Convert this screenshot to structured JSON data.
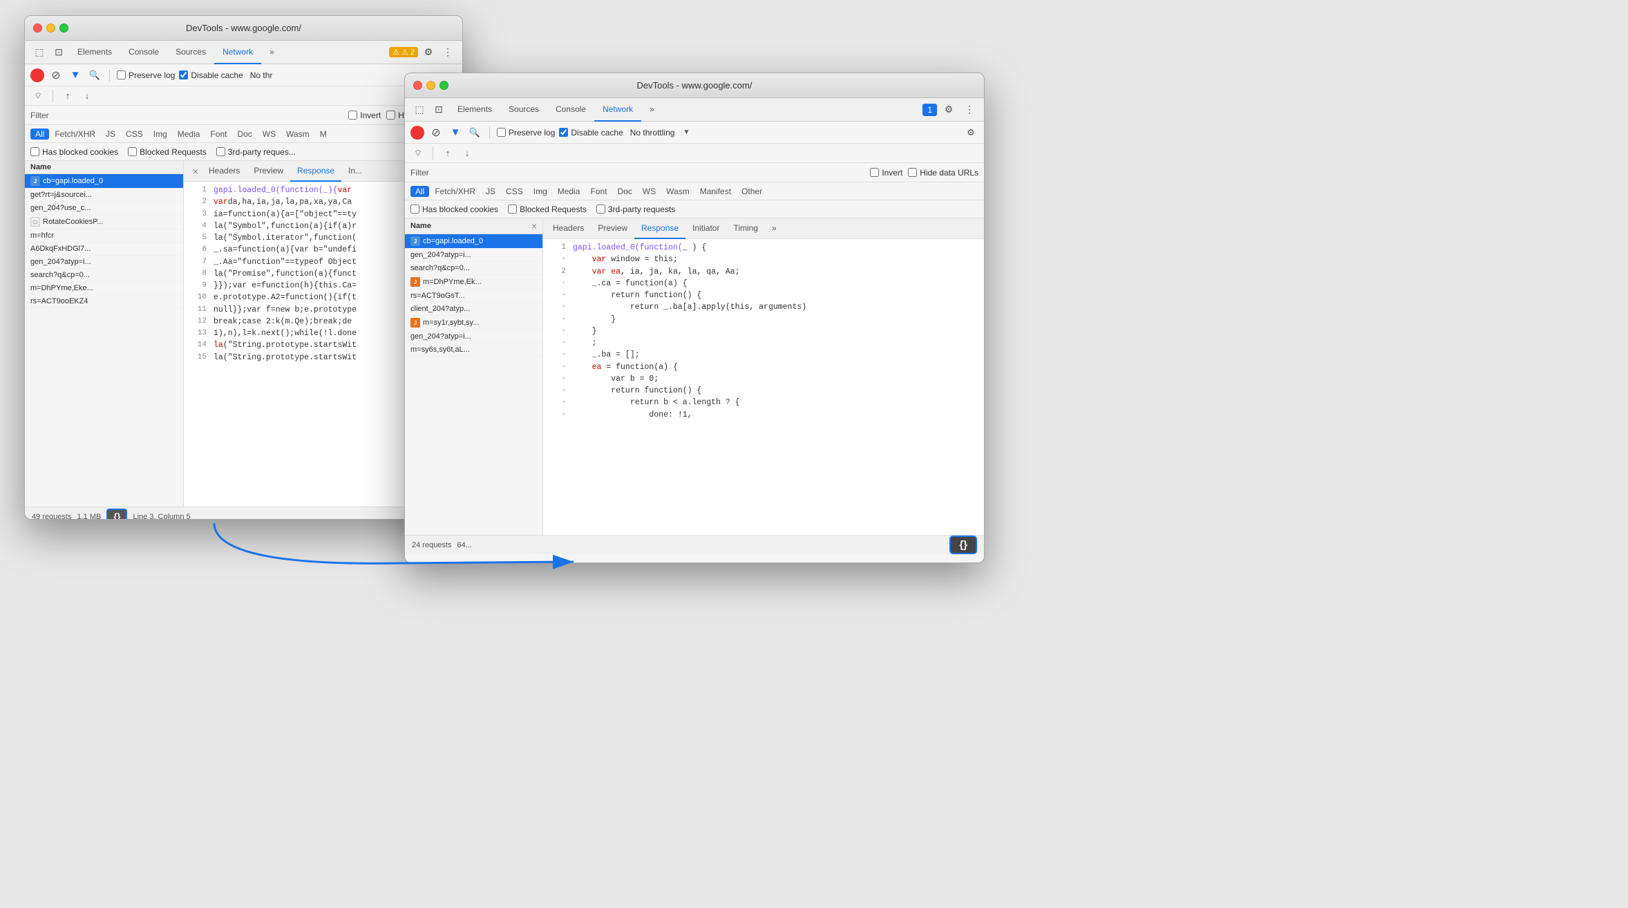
{
  "window1": {
    "title": "DevTools - www.google.com/",
    "tabs": [
      {
        "label": "Elements",
        "active": false
      },
      {
        "label": "Console",
        "active": false
      },
      {
        "label": "Sources",
        "active": false
      },
      {
        "label": "Network",
        "active": true
      },
      {
        "label": "»",
        "active": false
      }
    ],
    "badgeLabel": "⚠ 2",
    "toolbar": {
      "preserveLog": "Preserve log",
      "disableCache": "Disable cache",
      "noThrottle": "No thr"
    },
    "filter": {
      "label": "Filter",
      "invertLabel": "Invert",
      "hideDataURLs": "Hide data URLs"
    },
    "typeFilters": [
      "All",
      "Fetch/XHR",
      "JS",
      "CSS",
      "Img",
      "Media",
      "Font",
      "Doc",
      "WS",
      "Wasm",
      "M"
    ],
    "checkboxes": {
      "hasCookies": "Has blocked cookies",
      "blockedRequests": "Blocked Requests",
      "thirdParty": "3rd-party reques..."
    },
    "requestsHeader": "Name",
    "requests": [
      {
        "name": "cb=gapi.loaded_0",
        "icon": "blue",
        "selected": true
      },
      {
        "name": "get?rt=j&sourcei...",
        "icon": "none"
      },
      {
        "name": "gen_204?use_c...",
        "icon": "none"
      },
      {
        "name": "RotateCookiesP...",
        "icon": "page"
      },
      {
        "name": "m=hfcr",
        "icon": "none"
      },
      {
        "name": "A6DkqFxHDGl7...",
        "icon": "none"
      },
      {
        "name": "gen_204?atyp=i...",
        "icon": "none"
      },
      {
        "name": "search?q&cp=0...",
        "icon": "none"
      },
      {
        "name": "m=DhPYme,Eke...",
        "icon": "none"
      },
      {
        "name": "rs=ACT9ooEKZ4",
        "icon": "none"
      }
    ],
    "tabs2": [
      "Headers",
      "Preview",
      "Response",
      "In..."
    ],
    "codeLines": [
      {
        "num": "1",
        "text": "gapi.loaded_0(function(_){var "
      },
      {
        "num": "2",
        "text": "var da,ha,ia,ja,la,pa,xa,ya,Ca"
      },
      {
        "num": "3",
        "text": "ia=function(a){a=[\"object\"==ty"
      },
      {
        "num": "4",
        "text": "la(\"Symbol\",function(a){if(a)r"
      },
      {
        "num": "5",
        "text": "la(\"Symbol.iterator\",function("
      },
      {
        "num": "6",
        "text": "_.sa=function(a){var b=\"undefi"
      },
      {
        "num": "7",
        "text": "_.Aa=\"function\"==typeof Object"
      },
      {
        "num": "8",
        "text": "la(\"Promise\",function(a){funct"
      },
      {
        "num": "9",
        "text": "}});var e=function(h){this.Ca="
      },
      {
        "num": "10",
        "text": "e.prototype.A2=function(){if(t"
      },
      {
        "num": "11",
        "text": "null}};var f=new b;e.prototype"
      },
      {
        "num": "12",
        "text": "break;case 2:k(m.Qe);break;de"
      },
      {
        "num": "13",
        "text": "1),n),l=k.next();while(!l.done"
      },
      {
        "num": "14",
        "text": "la(\"String.prototype.startsWith"
      }
    ],
    "statusBar": {
      "requests": "49 requests",
      "size": "1.1 MB",
      "formatBtnLabel": "{}",
      "position": "Line 3, Column 5"
    }
  },
  "window2": {
    "title": "DevTools - www.google.com/",
    "tabs": [
      {
        "label": "Elements",
        "active": false
      },
      {
        "label": "Sources",
        "active": false
      },
      {
        "label": "Console",
        "active": false
      },
      {
        "label": "Network",
        "active": true
      },
      {
        "label": "»",
        "active": false
      }
    ],
    "badgeLabel": "1",
    "toolbar": {
      "preserveLog": "Preserve log",
      "disableCache": "Disable cache",
      "noThrottle": "No throttling"
    },
    "filter": {
      "label": "Filter",
      "invertLabel": "Invert",
      "hideDataURLs": "Hide data URLs"
    },
    "typeFilters": [
      "All",
      "Fetch/XHR",
      "JS",
      "CSS",
      "Img",
      "Media",
      "Font",
      "Doc",
      "WS",
      "Wasm",
      "Manifest",
      "Other"
    ],
    "checkboxes": {
      "hasCookies": "Has blocked cookies",
      "blockedRequests": "Blocked Requests",
      "thirdParty": "3rd-party requests"
    },
    "requestsHeader": "Name",
    "requests": [
      {
        "name": "cb=gapi.loaded_0",
        "icon": "blue",
        "selected": true
      },
      {
        "name": "gen_204?atyp=i...",
        "icon": "none"
      },
      {
        "name": "search?q&cp=0...",
        "icon": "none"
      },
      {
        "name": "m=DhPYme,Ek...",
        "icon": "orange"
      },
      {
        "name": "rs=ACT9oGsT...",
        "icon": "none"
      },
      {
        "name": "client_204?atyp...",
        "icon": "none"
      },
      {
        "name": "m=sy1r,sybt,sy...",
        "icon": "orange"
      },
      {
        "name": "gen_204?atyp=i...",
        "icon": "none"
      },
      {
        "name": "m=sy6s,sy6t,aL...",
        "icon": "none"
      }
    ],
    "detailTabs": [
      "Headers",
      "Preview",
      "Response",
      "Initiator",
      "Timing",
      "»"
    ],
    "codeLines": [
      {
        "num": "1",
        "dash": false,
        "text": "gapi.loaded_0(function(_ ) {"
      },
      {
        "num": "",
        "dash": true,
        "text": "    var window = this;"
      },
      {
        "num": "2",
        "dash": false,
        "text": "    var ea, ia, ja, ka, la, qa, Aa;"
      },
      {
        "num": "",
        "dash": true,
        "text": "    _.ca = function(a) {"
      },
      {
        "num": "",
        "dash": true,
        "text": "        return function() {"
      },
      {
        "num": "",
        "dash": true,
        "text": "            return _.ba[a].apply(this, arguments)"
      },
      {
        "num": "",
        "dash": true,
        "text": "        }"
      },
      {
        "num": "",
        "dash": true,
        "text": "    }"
      },
      {
        "num": "",
        "dash": true,
        "text": "    ;"
      },
      {
        "num": "",
        "dash": true,
        "text": "    _.ba = [];"
      },
      {
        "num": "",
        "dash": true,
        "text": "    ea = function(a) {"
      },
      {
        "num": "",
        "dash": true,
        "text": "        var b = 0;"
      },
      {
        "num": "",
        "dash": true,
        "text": "        return function() {"
      },
      {
        "num": "",
        "dash": true,
        "text": "            return b < a.length ? {"
      },
      {
        "num": "",
        "dash": true,
        "text": "                done: !1,"
      }
    ],
    "statusBar": {
      "requests": "24 requests",
      "size": "64...",
      "formatBtnLabel": "{}"
    },
    "eaText": "ea"
  },
  "icons": {
    "cursor": "⬚",
    "panel": "⊡",
    "record": "●",
    "stop": "⊘",
    "filter": "▼",
    "search": "🔍",
    "settings": "⚙",
    "dots": "⋮",
    "upload": "↑",
    "download": "↓",
    "wifi": "⌔",
    "chevron": "▼",
    "close": "×"
  }
}
